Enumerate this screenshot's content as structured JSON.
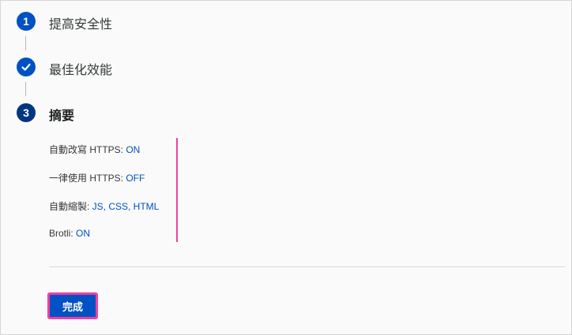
{
  "steps": [
    {
      "number": "1",
      "label": "提高安全性",
      "state": "numbered"
    },
    {
      "number": "",
      "label": "最佳化效能",
      "state": "completed",
      "icon": "checkmark-icon"
    },
    {
      "number": "3",
      "label": "摘要",
      "state": "active"
    }
  ],
  "summary": {
    "rows": [
      {
        "label": "自動改寫 HTTPS: ",
        "value": "ON"
      },
      {
        "label": "一律使用 HTTPS: ",
        "value": "OFF"
      },
      {
        "label": "自動縮製: ",
        "value": "JS, CSS, HTML"
      },
      {
        "label": "Brotli: ",
        "value": "ON"
      }
    ]
  },
  "actions": {
    "done_label": "完成"
  },
  "colors": {
    "accent": "#0051c3",
    "accent_dark": "#003681",
    "highlight": "#ee3fa1"
  }
}
